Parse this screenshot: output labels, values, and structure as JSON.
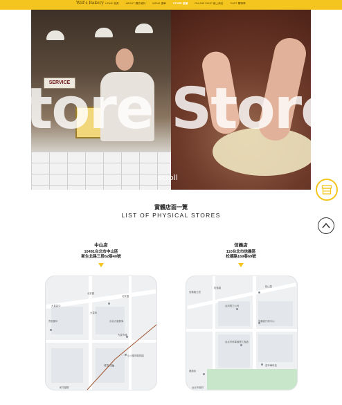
{
  "nav": {
    "brand": "Will's Bakery",
    "items": [
      {
        "label": "HOME 首頁",
        "active": false
      },
      {
        "label": "ABOUT 關於威列",
        "active": false
      },
      {
        "label": "MENU 選單",
        "active": false
      },
      {
        "label": "STORE 店鋪",
        "active": true
      },
      {
        "label": "ONLINE SHOP 線上商店",
        "active": false
      },
      {
        "label": "CART 購物車",
        "active": false
      }
    ]
  },
  "hero": {
    "marquee": "tore Store Sto",
    "sign": "SERVICE",
    "scroll_label": "scroll"
  },
  "section": {
    "title_zh": "實體店面一覽",
    "title_en": "LIST OF PHYSICAL STORES"
  },
  "stores": [
    {
      "name": "中山店",
      "address_line1": "10491台北市中山區",
      "address_line2": "新生北路三段62巷40號",
      "map_labels": [
        "北安路",
        "長安國中",
        "大直高中",
        "大直街",
        "大直市場",
        "台北大直郵局",
        "小小樹林動物園",
        "堤頂公園",
        "和平國際",
        "北安路"
      ]
    },
    {
      "name": "信義店",
      "address_line1": "110台北市信義區",
      "address_line2": "松德路169巷69號",
      "map_labels": [
        "信義路五段",
        "松德路",
        "台灣電力公司",
        "台北市停車管理工程處",
        "信義區行政中心",
        "松山區",
        "嘉年華科技",
        "福德街",
        "台北市政府"
      ]
    }
  ],
  "colors": {
    "accent": "#f4c51f",
    "text": "#222222"
  }
}
